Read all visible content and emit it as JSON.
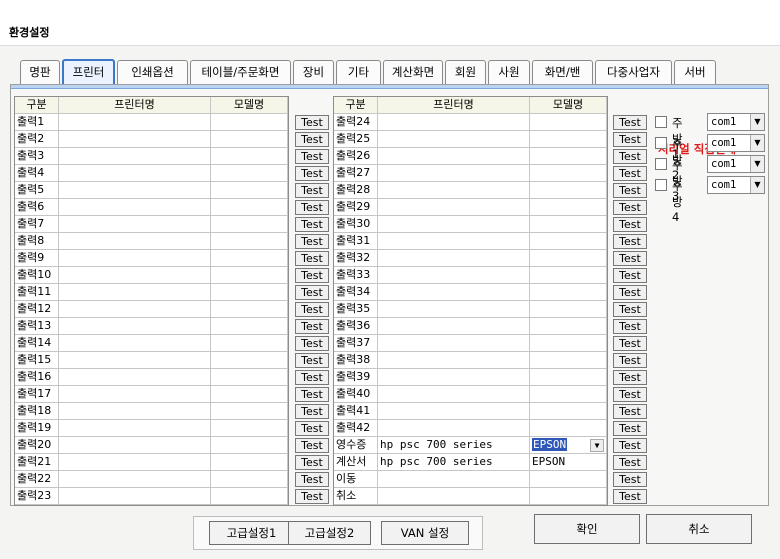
{
  "window": {
    "title": "환경설정"
  },
  "tabs": [
    "명판",
    "프린터",
    "인쇄옵션",
    "테이블/주문화면",
    "장비",
    "기타",
    "계산화면",
    "회원",
    "사원",
    "화면/밴",
    "다중사업자",
    "서버"
  ],
  "active_tab": 1,
  "left_table": {
    "headers": [
      "구분",
      "프린터명",
      "모델명"
    ],
    "rows": [
      {
        "label": "출력1",
        "printer": "",
        "model": ""
      },
      {
        "label": "출력2",
        "printer": "",
        "model": ""
      },
      {
        "label": "출력3",
        "printer": "",
        "model": ""
      },
      {
        "label": "출력4",
        "printer": "",
        "model": ""
      },
      {
        "label": "출력5",
        "printer": "",
        "model": ""
      },
      {
        "label": "출력6",
        "printer": "",
        "model": ""
      },
      {
        "label": "출력7",
        "printer": "",
        "model": ""
      },
      {
        "label": "출력8",
        "printer": "",
        "model": ""
      },
      {
        "label": "출력9",
        "printer": "",
        "model": ""
      },
      {
        "label": "출력10",
        "printer": "",
        "model": ""
      },
      {
        "label": "출력11",
        "printer": "",
        "model": ""
      },
      {
        "label": "출력12",
        "printer": "",
        "model": ""
      },
      {
        "label": "출력13",
        "printer": "",
        "model": ""
      },
      {
        "label": "출력14",
        "printer": "",
        "model": ""
      },
      {
        "label": "출력15",
        "printer": "",
        "model": ""
      },
      {
        "label": "출력16",
        "printer": "",
        "model": ""
      },
      {
        "label": "출력17",
        "printer": "",
        "model": ""
      },
      {
        "label": "출력18",
        "printer": "",
        "model": ""
      },
      {
        "label": "출력19",
        "printer": "",
        "model": ""
      },
      {
        "label": "출력20",
        "printer": "",
        "model": ""
      },
      {
        "label": "출력21",
        "printer": "",
        "model": ""
      },
      {
        "label": "출력22",
        "printer": "",
        "model": ""
      },
      {
        "label": "출력23",
        "printer": "",
        "model": ""
      }
    ]
  },
  "right_table": {
    "headers": [
      "구분",
      "프린터명",
      "모델명"
    ],
    "rows": [
      {
        "label": "출력24",
        "printer": "",
        "model": ""
      },
      {
        "label": "출력25",
        "printer": "",
        "model": ""
      },
      {
        "label": "출력26",
        "printer": "",
        "model": ""
      },
      {
        "label": "출력27",
        "printer": "",
        "model": ""
      },
      {
        "label": "출력28",
        "printer": "",
        "model": ""
      },
      {
        "label": "출력29",
        "printer": "",
        "model": ""
      },
      {
        "label": "출력30",
        "printer": "",
        "model": ""
      },
      {
        "label": "출력31",
        "printer": "",
        "model": ""
      },
      {
        "label": "출력32",
        "printer": "",
        "model": ""
      },
      {
        "label": "출력33",
        "printer": "",
        "model": ""
      },
      {
        "label": "출력34",
        "printer": "",
        "model": ""
      },
      {
        "label": "출력35",
        "printer": "",
        "model": ""
      },
      {
        "label": "출력36",
        "printer": "",
        "model": ""
      },
      {
        "label": "출력37",
        "printer": "",
        "model": ""
      },
      {
        "label": "출력38",
        "printer": "",
        "model": ""
      },
      {
        "label": "출력39",
        "printer": "",
        "model": ""
      },
      {
        "label": "출력40",
        "printer": "",
        "model": ""
      },
      {
        "label": "출력41",
        "printer": "",
        "model": ""
      },
      {
        "label": "출력42",
        "printer": "",
        "model": ""
      },
      {
        "label": "영수증",
        "printer": "hp psc 700 series",
        "model": "EPSON",
        "selected": true
      },
      {
        "label": "계산서",
        "printer": "hp psc 700 series",
        "model": "EPSON"
      },
      {
        "label": "이동",
        "printer": "",
        "model": ""
      },
      {
        "label": "취소",
        "printer": "",
        "model": ""
      }
    ]
  },
  "test_label": "Test",
  "serial": {
    "title": "시리얼 직접인쇄",
    "items": [
      {
        "label": "주방1",
        "port": "com1"
      },
      {
        "label": "주방2",
        "port": "com1"
      },
      {
        "label": "주방3",
        "port": "com1"
      },
      {
        "label": "주방4",
        "port": "com1"
      }
    ]
  },
  "footer": {
    "advanced1": "고급설정1",
    "advanced2": "고급설정2",
    "van": "VAN 설정",
    "ok": "확인",
    "cancel": "취소"
  },
  "colors": {
    "active_tab_border": "#3d78c8",
    "serial_title": "#e01b1b",
    "selection": "#2f57b8"
  }
}
